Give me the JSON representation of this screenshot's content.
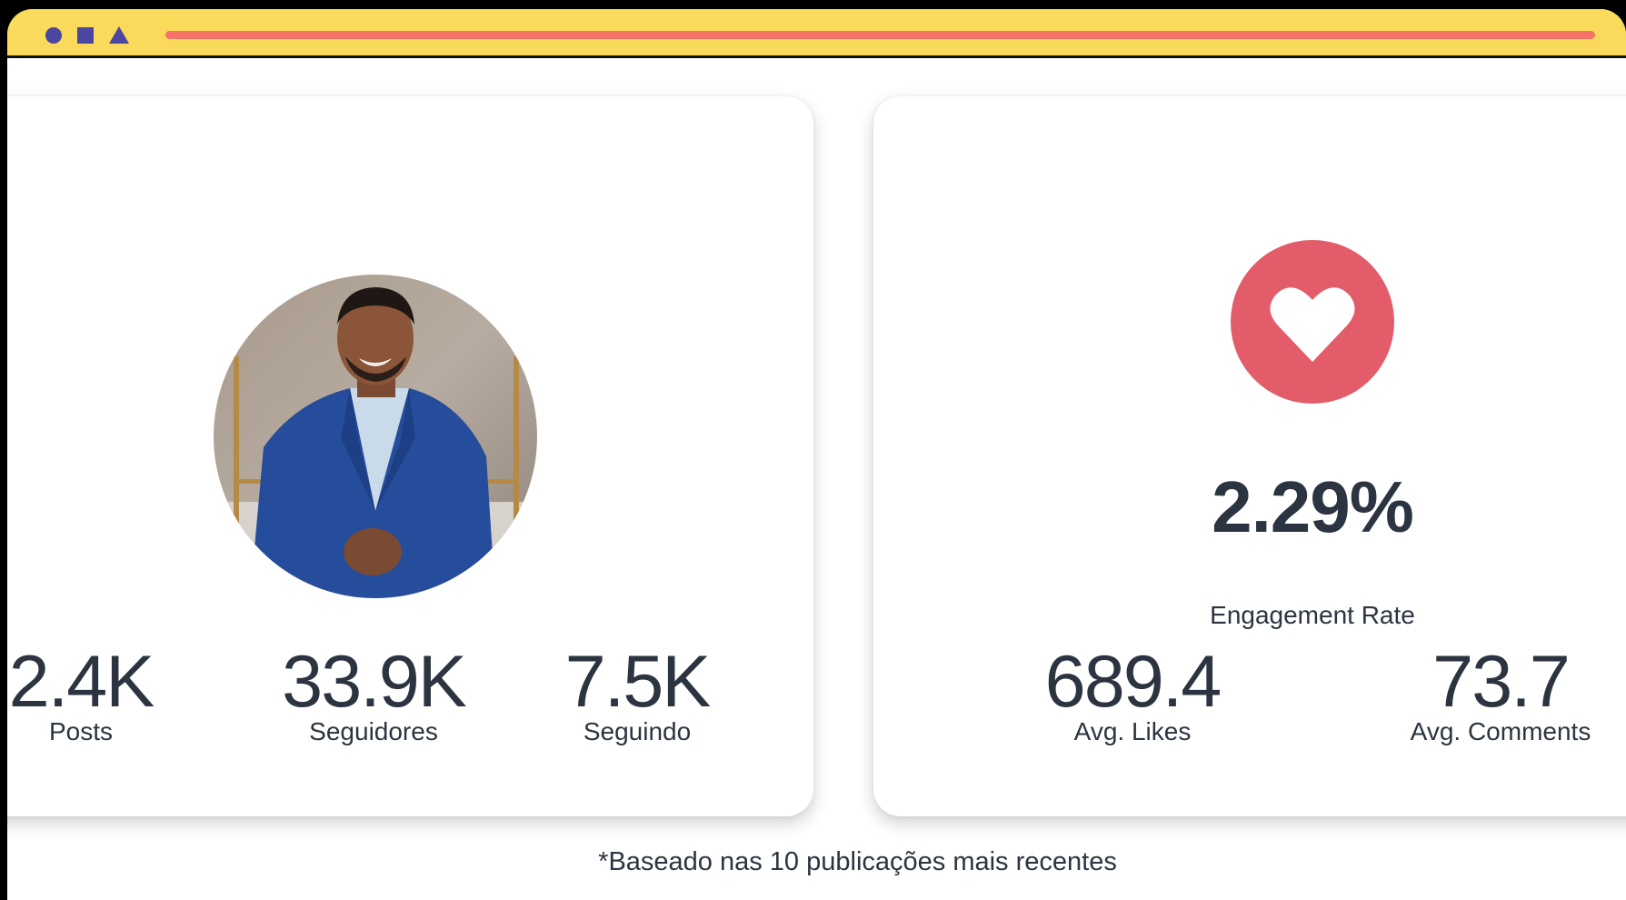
{
  "titlebar": {
    "shapes": [
      "circle-icon",
      "square-icon",
      "triangle-icon"
    ],
    "accent_color": "#f9da5a",
    "shape_color": "#4b47a0",
    "bar_color": "#f6736a"
  },
  "profile_card": {
    "avatar_alt": "profile photo",
    "stats": [
      {
        "value": "2.4K",
        "label": "Posts"
      },
      {
        "value": "33.9K",
        "label": "Seguidores"
      },
      {
        "value": "7.5K",
        "label": "Seguindo"
      }
    ]
  },
  "engagement_card": {
    "icon": "heart-icon",
    "icon_bg": "#e25c6a",
    "rate_value": "2.29%",
    "rate_label": "Engagement Rate",
    "stats": [
      {
        "value": "689.4",
        "label": "Avg. Likes"
      },
      {
        "value": "73.7",
        "label": "Avg. Comments"
      }
    ]
  },
  "footnote": "*Baseado nas 10 publicações mais recentes"
}
